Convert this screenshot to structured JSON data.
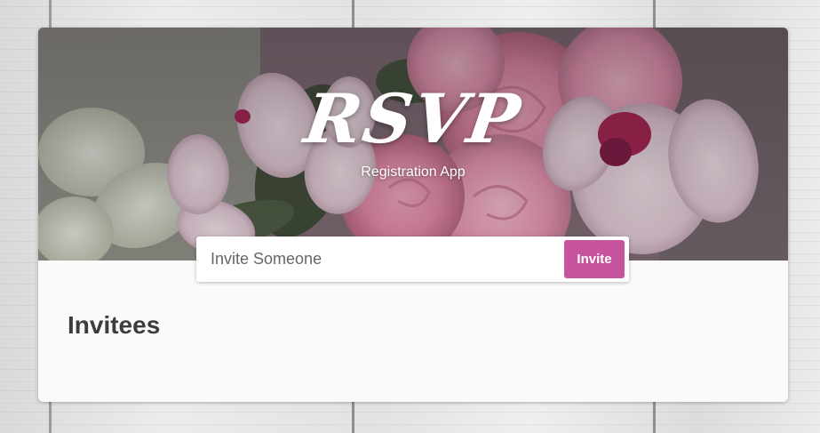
{
  "header": {
    "title": "RSVP",
    "subtitle": "Registration App"
  },
  "form": {
    "input_placeholder": "Invite Someone",
    "input_value": "",
    "submit_label": "Invite"
  },
  "main": {
    "heading": "Invitees",
    "invitees": []
  },
  "colors": {
    "accent": "#c6549d",
    "card_background": "#fafafa",
    "heading_text": "#3d3d3d"
  }
}
